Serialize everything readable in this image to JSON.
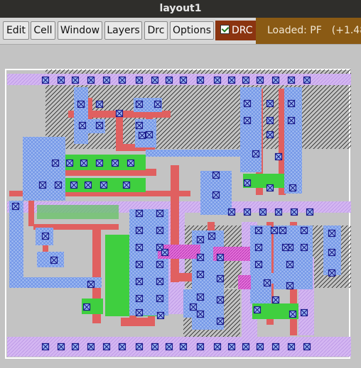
{
  "window": {
    "title": "layout1"
  },
  "menu": {
    "items": [
      {
        "label": "Edit"
      },
      {
        "label": "Cell"
      },
      {
        "label": "Window"
      },
      {
        "label": "Layers"
      },
      {
        "label": "Drc"
      },
      {
        "label": "Options"
      }
    ],
    "drc_toggle": {
      "label": "DRC",
      "checked": true
    }
  },
  "status": {
    "loaded_text": "Loaded: PF",
    "offset_text": "(+1.48"
  },
  "colors": {
    "poly": "#e05a5a",
    "diffusion": "#3fcf3f",
    "metal1": "#7aa7ee",
    "metal2": "#cfa8ee",
    "contact": "#1f3fd8",
    "nwell_hatch": "#1a1a1a"
  }
}
